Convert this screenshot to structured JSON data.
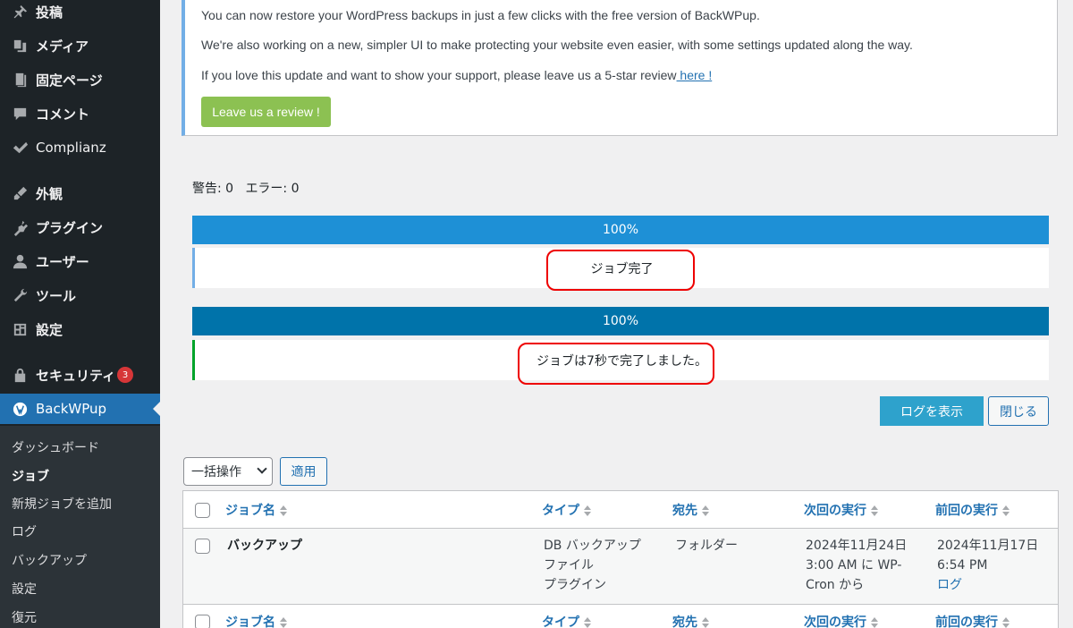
{
  "sidebar": {
    "items": [
      {
        "label": "投稿",
        "icon": "pin-icon"
      },
      {
        "label": "メディア",
        "icon": "media-icon"
      },
      {
        "label": "固定ページ",
        "icon": "page-icon"
      },
      {
        "label": "コメント",
        "icon": "comment-icon"
      },
      {
        "label": "Complianz",
        "icon": "check-icon"
      },
      {
        "label": "外観",
        "icon": "brush-icon"
      },
      {
        "label": "プラグイン",
        "icon": "plugin-icon"
      },
      {
        "label": "ユーザー",
        "icon": "user-icon"
      },
      {
        "label": "ツール",
        "icon": "wrench-icon"
      },
      {
        "label": "設定",
        "icon": "settings-icon"
      },
      {
        "label": "セキュリティ",
        "icon": "lock-icon",
        "badge": "3"
      },
      {
        "label": "BackWPup",
        "icon": "backwpup-icon"
      }
    ],
    "submenu": [
      "ダッシュボード",
      "ジョブ",
      "新規ジョブを追加",
      "ログ",
      "バックアップ",
      "設定",
      "復元"
    ]
  },
  "notice": {
    "line1": "You can now restore your WordPress backups in just a few clicks with the free version of BackWPup.",
    "line2": "We're also working on a new, simpler UI to make protecting your website even easier, with some settings updated along the way.",
    "line3": "If you love this update and want to show your support, please leave us a 5-star review",
    "link": " here !",
    "button": "Leave us a review !"
  },
  "counts": {
    "warnings": "警告: 0",
    "errors": "エラー: 0"
  },
  "progress": [
    {
      "label": "100%",
      "value": 100,
      "color": "#1e90d6",
      "status": "ジョブ完了",
      "border": "#72aee6"
    },
    {
      "label": "100%",
      "value": 100,
      "color": "#0073aa",
      "status": "ジョブは7秒で完了しました。",
      "border": "#00a32a"
    }
  ],
  "actions": {
    "show_log": "ログを表示",
    "close": "閉じる"
  },
  "bulk": {
    "selected": "一括操作",
    "apply": "適用"
  },
  "table": {
    "headers": [
      "ジョブ名",
      "タイプ",
      "宛先",
      "次回の実行",
      "前回の実行"
    ],
    "rows": [
      {
        "name": "バックアップ",
        "type": [
          "DB バックアップ",
          "ファイル",
          "プラグイン"
        ],
        "dest": "フォルダー",
        "next": [
          "2024年11月24日",
          "3:00 AM に WP-",
          "Cron から"
        ],
        "last": [
          "2024年11月17日",
          "6:54 PM"
        ],
        "last_link": "ログ"
      }
    ]
  }
}
